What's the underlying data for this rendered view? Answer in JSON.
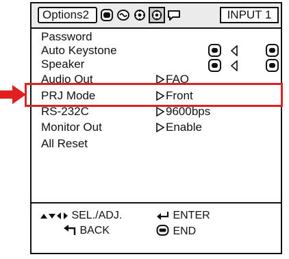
{
  "header": {
    "menu_tab": "Options2",
    "input_label": "INPUT 1",
    "icons": [
      "picture-menu-icon",
      "sound-menu-icon",
      "options1-menu-icon",
      "options2-menu-icon",
      "language-menu-icon"
    ]
  },
  "menu": {
    "items": [
      {
        "label": "Password",
        "value": ""
      },
      {
        "label": "Auto Keystone",
        "value": ""
      },
      {
        "label": "Speaker",
        "value": ""
      },
      {
        "label": "Audio Out",
        "value": "FAO"
      },
      {
        "label": "PRJ Mode",
        "value": "Front"
      },
      {
        "label": "RS-232C",
        "value": "9600bps"
      },
      {
        "label": "Monitor Out",
        "value": "Enable"
      },
      {
        "label": "All Reset",
        "value": ""
      }
    ],
    "highlighted": "PRJ Mode"
  },
  "footer": {
    "sel_adj": "SEL./ADJ.",
    "enter": "ENTER",
    "back": "BACK",
    "end": "END"
  },
  "colors": {
    "highlight": "#e02020",
    "header_bg": "#ebebeb"
  }
}
